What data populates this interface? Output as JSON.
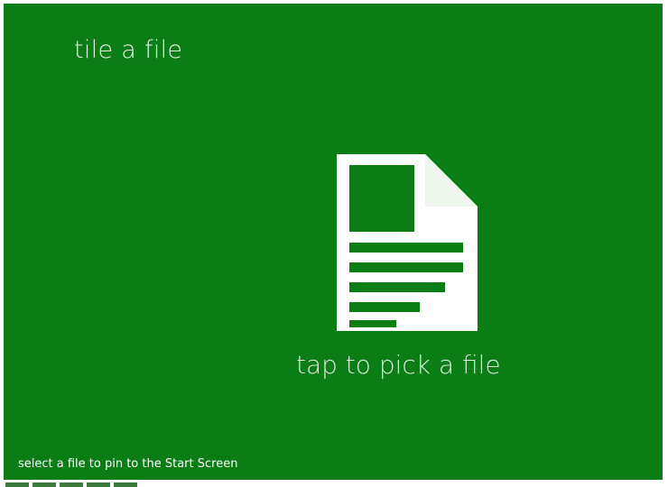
{
  "app": {
    "title": "tile a file",
    "background_color": "#0a7d14"
  },
  "picker": {
    "label": "tap to pick a file",
    "icon": "file-document-icon"
  },
  "footer": {
    "hint": "select a file to pin to the Start Screen"
  }
}
